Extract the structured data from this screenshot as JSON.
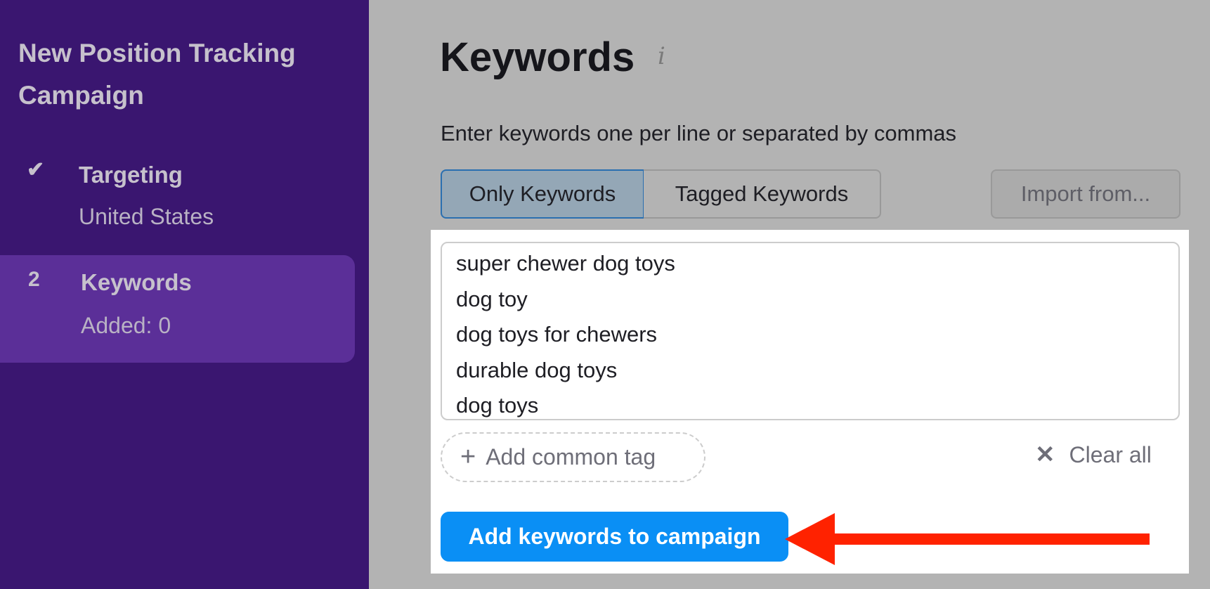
{
  "sidebar": {
    "title": "New Position Tracking Campaign",
    "steps": [
      {
        "mark": "✔",
        "label": "Targeting",
        "sub": "United States",
        "state": "completed"
      },
      {
        "mark": "2",
        "label": "Keywords",
        "sub": "Added: 0",
        "state": "active"
      }
    ]
  },
  "main": {
    "title": "Keywords",
    "info_icon": "i",
    "subtitle": "Enter keywords one per line or separated by commas",
    "tabs": [
      {
        "label": "Only Keywords",
        "selected": true
      },
      {
        "label": "Tagged Keywords",
        "selected": false
      }
    ],
    "import_label": "Import from...",
    "keywords": [
      "super chewer dog toys",
      "dog toy",
      "dog toys for chewers",
      "durable dog toys",
      "dog toys"
    ],
    "add_tag_icon": "+",
    "add_tag_label": "Add common tag",
    "clear_icon": "✕",
    "clear_label": "Clear all",
    "submit_label": "Add keywords to campaign"
  },
  "colors": {
    "sidebar": "#3a1670",
    "active_step": "#5b2f98",
    "primary": "#0a8ff5",
    "annotation_arrow": "#ff2200"
  }
}
